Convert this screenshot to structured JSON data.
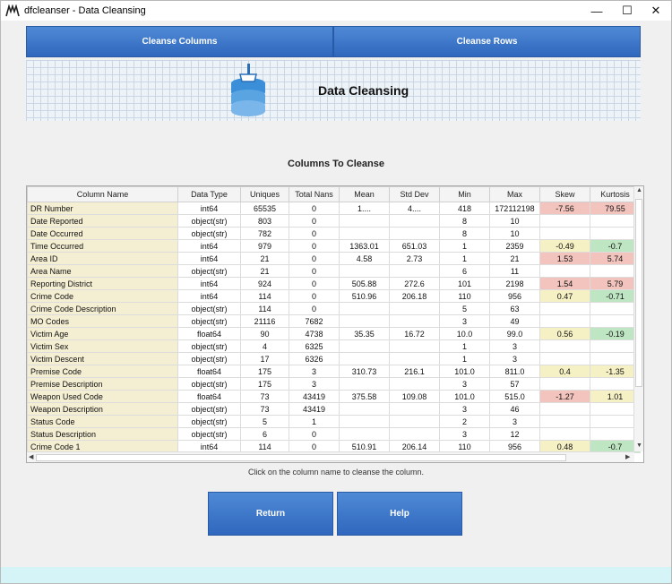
{
  "window": {
    "title": "dfcleanser - Data Cleansing"
  },
  "controls": {
    "minimize": "—",
    "maximize": "☐",
    "close": "✕"
  },
  "top_buttons": {
    "cleanse_columns": "Cleanse Columns",
    "cleanse_rows": "Cleanse Rows"
  },
  "banner": {
    "title": "Data Cleansing",
    "icon": "database-broom-icon"
  },
  "section_title": "Columns To Cleanse",
  "table": {
    "headers": [
      "Column Name",
      "Data Type",
      "Uniques",
      "Total Nans",
      "Mean",
      "Std Dev",
      "Min",
      "Max",
      "Skew",
      "Kurtosis"
    ],
    "rows": [
      [
        "DR Number",
        "int64",
        "65535",
        "0",
        "1....",
        "4....",
        "418",
        "172112198",
        "-7.56",
        "79.55"
      ],
      [
        "Date Reported",
        "object(str)",
        "803",
        "0",
        "",
        "",
        "8",
        "10",
        "",
        ""
      ],
      [
        "Date Occurred",
        "object(str)",
        "782",
        "0",
        "",
        "",
        "8",
        "10",
        "",
        ""
      ],
      [
        "Time Occurred",
        "int64",
        "979",
        "0",
        "1363.01",
        "651.03",
        "1",
        "2359",
        "-0.49",
        "-0.7"
      ],
      [
        "Area ID",
        "int64",
        "21",
        "0",
        "4.58",
        "2.73",
        "1",
        "21",
        "1.53",
        "5.74"
      ],
      [
        "Area Name",
        "object(str)",
        "21",
        "0",
        "",
        "",
        "6",
        "11",
        "",
        ""
      ],
      [
        "Reporting District",
        "int64",
        "924",
        "0",
        "505.88",
        "272.6",
        "101",
        "2198",
        "1.54",
        "5.79"
      ],
      [
        "Crime Code",
        "int64",
        "114",
        "0",
        "510.96",
        "206.18",
        "110",
        "956",
        "0.47",
        "-0.71"
      ],
      [
        "Crime Code Description",
        "object(str)",
        "114",
        "0",
        "",
        "",
        "5",
        "63",
        "",
        ""
      ],
      [
        "MO Codes",
        "object(str)",
        "21116",
        "7682",
        "",
        "",
        "3",
        "49",
        "",
        ""
      ],
      [
        "Victim Age",
        "float64",
        "90",
        "4738",
        "35.35",
        "16.72",
        "10.0",
        "99.0",
        "0.56",
        "-0.19"
      ],
      [
        "Victim Sex",
        "object(str)",
        "4",
        "6325",
        "",
        "",
        "1",
        "3",
        "",
        ""
      ],
      [
        "Victim Descent",
        "object(str)",
        "17",
        "6326",
        "",
        "",
        "1",
        "3",
        "",
        ""
      ],
      [
        "Premise Code",
        "float64",
        "175",
        "3",
        "310.73",
        "216.1",
        "101.0",
        "811.0",
        "0.4",
        "-1.35"
      ],
      [
        "Premise Description",
        "object(str)",
        "175",
        "3",
        "",
        "",
        "3",
        "57",
        "",
        ""
      ],
      [
        "Weapon Used Code",
        "float64",
        "73",
        "43419",
        "375.58",
        "109.08",
        "101.0",
        "515.0",
        "-1.27",
        "1.01"
      ],
      [
        "Weapon Description",
        "object(str)",
        "73",
        "43419",
        "",
        "",
        "3",
        "46",
        "",
        ""
      ],
      [
        "Status Code",
        "object(str)",
        "5",
        "1",
        "",
        "",
        "2",
        "3",
        "",
        ""
      ],
      [
        "Status Description",
        "object(str)",
        "6",
        "0",
        "",
        "",
        "3",
        "12",
        "",
        ""
      ],
      [
        "Crime Code 1",
        "int64",
        "114",
        "0",
        "510.91",
        "206.14",
        "110",
        "956",
        "0.48",
        "-0.7"
      ]
    ],
    "skew_colors": [
      "red",
      "",
      "",
      "yellow",
      "red",
      "",
      "red",
      "yellow",
      "",
      "",
      "yellow",
      "",
      "",
      "yellow",
      "",
      "red",
      "",
      "",
      "",
      "yellow"
    ],
    "kurtosis_colors": [
      "red",
      "",
      "",
      "green",
      "red",
      "",
      "red",
      "green",
      "",
      "",
      "green",
      "",
      "",
      "yellow",
      "",
      "yellow",
      "",
      "",
      "",
      "green"
    ]
  },
  "hint": "Click on the column name to cleanse the column.",
  "buttons": {
    "return": "Return",
    "help": "Help"
  }
}
